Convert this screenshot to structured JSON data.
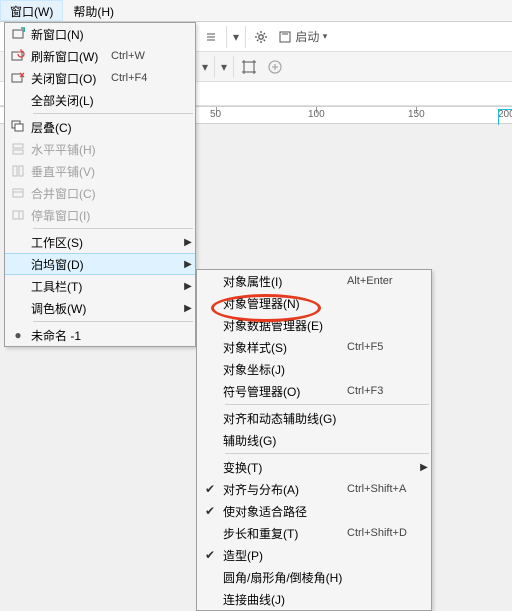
{
  "menubar": {
    "window": "窗口(W)",
    "help": "帮助(H)"
  },
  "toolbar": {
    "launch": "启动"
  },
  "ruler": {
    "t50": "50",
    "t100": "100",
    "t150": "150",
    "t200": "200"
  },
  "m1": {
    "new_window": "新窗口(N)",
    "refresh": "刷新窗口(W)",
    "refresh_k": "Ctrl+W",
    "close": "关闭窗口(O)",
    "close_k": "Ctrl+F4",
    "close_all": "全部关闭(L)",
    "cascade": "层叠(C)",
    "tile_h": "水平平铺(H)",
    "tile_v": "垂直平铺(V)",
    "merge": "合并窗口(C)",
    "stop": "停靠窗口(I)",
    "workspace": "工作区(S)",
    "dockers": "泊坞窗(D)",
    "toolbars": "工具栏(T)",
    "palettes": "调色板(W)",
    "doc": "未命名 -1"
  },
  "m2": {
    "obj_props": "对象属性(I)",
    "obj_props_k": "Alt+Enter",
    "obj_mgr": "对象管理器(N)",
    "obj_data": "对象数据管理器(E)",
    "obj_styles": "对象样式(S)",
    "obj_styles_k": "Ctrl+F5",
    "obj_coords": "对象坐标(J)",
    "symbol_mgr": "符号管理器(O)",
    "symbol_mgr_k": "Ctrl+F3",
    "align_dyn": "对齐和动态辅助线(G)",
    "guides": "辅助线(G)",
    "transform": "变换(T)",
    "align_dist": "对齐与分布(A)",
    "align_dist_k": "Ctrl+Shift+A",
    "fit_path": "使对象适合路径",
    "step_repeat": "步长和重复(T)",
    "step_repeat_k": "Ctrl+Shift+D",
    "shaping": "造型(P)",
    "corner": "圆角/扇形角/倒棱角(H)",
    "connect": "连接曲线(J)"
  }
}
